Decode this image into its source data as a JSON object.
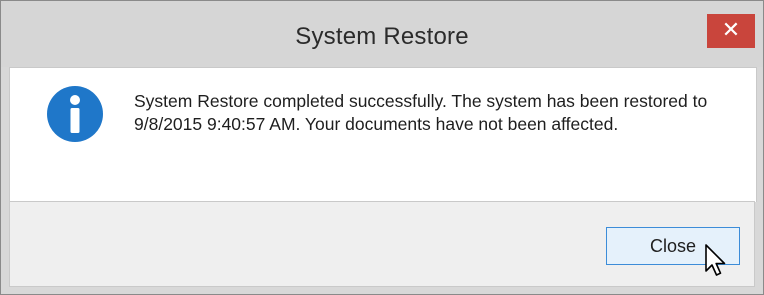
{
  "window": {
    "title": "System Restore",
    "close_glyph": "✕"
  },
  "dialog": {
    "icon": "info-icon",
    "message": "System Restore completed successfully. The system has been restored to 9/8/2015 9:40:57 AM. Your documents have not been affected."
  },
  "buttons": {
    "close_label": "Close"
  },
  "colors": {
    "titlebar": "#d6d6d6",
    "close_x_bg": "#c9453c",
    "info_icon": "#1f77c9",
    "button_focus_border": "#3c8cd8"
  }
}
